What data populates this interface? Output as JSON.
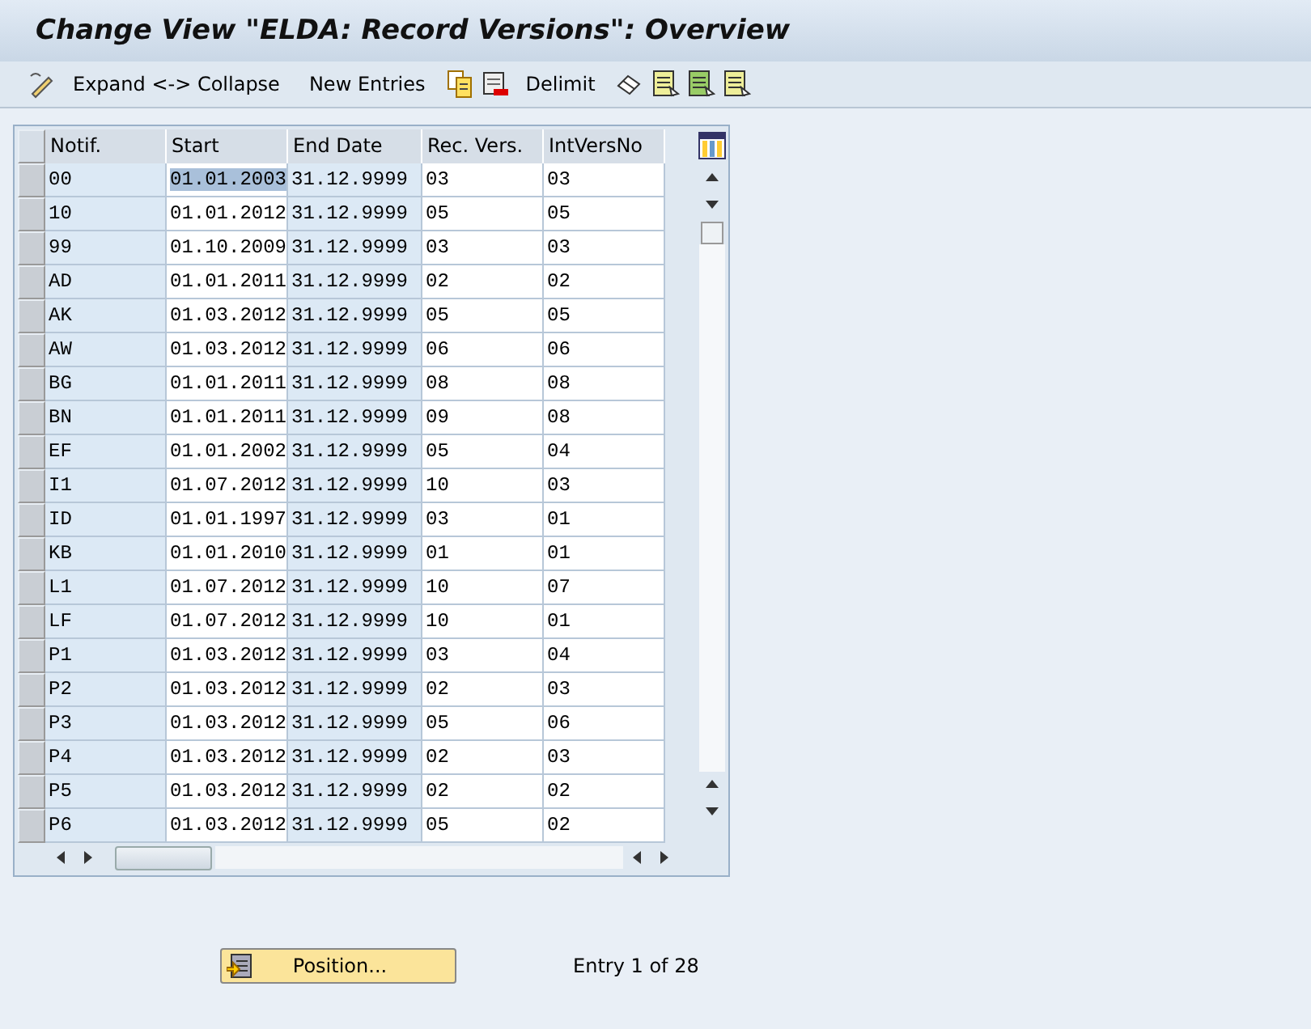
{
  "window": {
    "title": "Change View \"ELDA: Record Versions\": Overview"
  },
  "toolbar": [
    {
      "kind": "icon"
    },
    {
      "kind": "text",
      "label": "Expand <-> Collapse"
    },
    {
      "kind": "text",
      "label": "New Entries"
    },
    {
      "kind": "icon"
    },
    {
      "kind": "icon"
    },
    {
      "kind": "text",
      "label": "Delimit"
    },
    {
      "kind": "icon"
    },
    {
      "kind": "icon"
    },
    {
      "kind": "icon"
    },
    {
      "kind": "icon"
    }
  ],
  "table": {
    "columns": [
      {
        "label": "Notif.",
        "editable": false
      },
      {
        "label": "Start",
        "editable": true
      },
      {
        "label": "End Date",
        "editable": false
      },
      {
        "label": "Rec. Vers.",
        "editable": true
      },
      {
        "label": "IntVersNo",
        "editable": true
      }
    ],
    "rows": [
      {
        "cells": [
          "00",
          "01.01.2003",
          "31.12.9999",
          "03",
          "03"
        ],
        "start_highlighted": true
      },
      {
        "cells": [
          "10",
          "01.01.2012",
          "31.12.9999",
          "05",
          "05"
        ],
        "start_highlighted": false
      },
      {
        "cells": [
          "99",
          "01.10.2009",
          "31.12.9999",
          "03",
          "03"
        ],
        "start_highlighted": false
      },
      {
        "cells": [
          "AD",
          "01.01.2011",
          "31.12.9999",
          "02",
          "02"
        ],
        "start_highlighted": false
      },
      {
        "cells": [
          "AK",
          "01.03.2012",
          "31.12.9999",
          "05",
          "05"
        ],
        "start_highlighted": false
      },
      {
        "cells": [
          "AW",
          "01.03.2012",
          "31.12.9999",
          "06",
          "06"
        ],
        "start_highlighted": false
      },
      {
        "cells": [
          "BG",
          "01.01.2011",
          "31.12.9999",
          "08",
          "08"
        ],
        "start_highlighted": false
      },
      {
        "cells": [
          "BN",
          "01.01.2011",
          "31.12.9999",
          "09",
          "08"
        ],
        "start_highlighted": false
      },
      {
        "cells": [
          "EF",
          "01.01.2002",
          "31.12.9999",
          "05",
          "04"
        ],
        "start_highlighted": false
      },
      {
        "cells": [
          "I1",
          "01.07.2012",
          "31.12.9999",
          "10",
          "03"
        ],
        "start_highlighted": false
      },
      {
        "cells": [
          "ID",
          "01.01.1997",
          "31.12.9999",
          "03",
          "01"
        ],
        "start_highlighted": false
      },
      {
        "cells": [
          "KB",
          "01.01.2010",
          "31.12.9999",
          "01",
          "01"
        ],
        "start_highlighted": false
      },
      {
        "cells": [
          "L1",
          "01.07.2012",
          "31.12.9999",
          "10",
          "07"
        ],
        "start_highlighted": false
      },
      {
        "cells": [
          "LF",
          "01.07.2012",
          "31.12.9999",
          "10",
          "01"
        ],
        "start_highlighted": false
      },
      {
        "cells": [
          "P1",
          "01.03.2012",
          "31.12.9999",
          "03",
          "04"
        ],
        "start_highlighted": false
      },
      {
        "cells": [
          "P2",
          "01.03.2012",
          "31.12.9999",
          "02",
          "03"
        ],
        "start_highlighted": false
      },
      {
        "cells": [
          "P3",
          "01.03.2012",
          "31.12.9999",
          "05",
          "06"
        ],
        "start_highlighted": false
      },
      {
        "cells": [
          "P4",
          "01.03.2012",
          "31.12.9999",
          "02",
          "03"
        ],
        "start_highlighted": false
      },
      {
        "cells": [
          "P5",
          "01.03.2012",
          "31.12.9999",
          "02",
          "02"
        ],
        "start_highlighted": false
      },
      {
        "cells": [
          "P6",
          "01.03.2012",
          "31.12.9999",
          "05",
          "02"
        ],
        "start_highlighted": false
      }
    ]
  },
  "position_button": {
    "label": "Position..."
  },
  "entry_info": "Entry 1 of 28"
}
